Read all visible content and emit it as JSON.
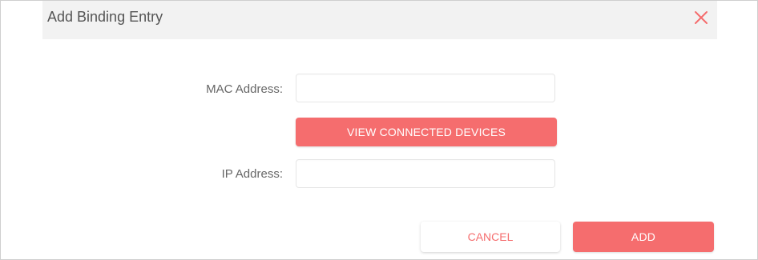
{
  "dialog": {
    "title": "Add Binding Entry",
    "close_icon": "close-icon"
  },
  "form": {
    "mac_label": "MAC Address:",
    "mac_value": "",
    "view_devices_label": "VIEW CONNECTED DEVICES",
    "ip_label": "IP Address:",
    "ip_value": ""
  },
  "footer": {
    "cancel_label": "CANCEL",
    "add_label": "ADD"
  },
  "colors": {
    "accent": "#f56d6e",
    "header_bg": "#f2f2f2",
    "text": "#555555"
  }
}
